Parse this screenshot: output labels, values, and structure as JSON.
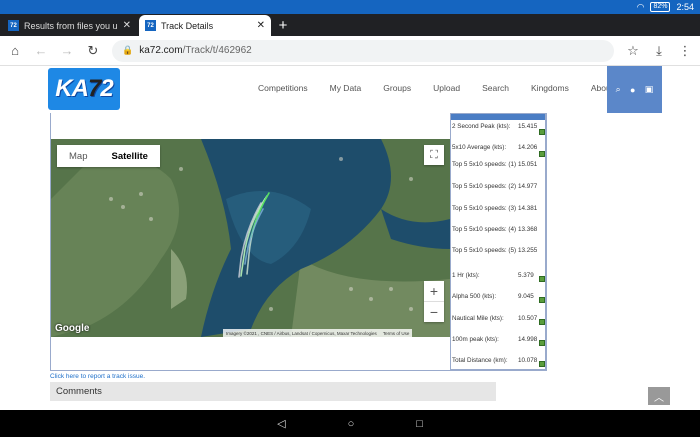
{
  "status_bar": {
    "battery": "82%",
    "time": "2:54"
  },
  "tabs": [
    {
      "title": "Results from files you uploa",
      "active": false
    },
    {
      "title": "Track Details",
      "active": true
    }
  ],
  "address": {
    "domain": "ka72.com",
    "path": "/Track/t/462962"
  },
  "site": {
    "logo_main": "KA",
    "logo_accent": "7",
    "logo_tail": "2",
    "nav": [
      "Competitions",
      "My Data",
      "Groups",
      "Upload",
      "Search",
      "Kingdoms",
      "About"
    ]
  },
  "map": {
    "toggle_map": "Map",
    "toggle_satellite": "Satellite",
    "google": "Google",
    "imagery": "Imagery ©2021 , CNES / Airbus, Landsat / Copernicus, Maxar Technologies",
    "terms": "Terms of Use",
    "zoom_in": "+",
    "zoom_out": "−"
  },
  "stats": [
    {
      "label": "2 Second Peak (kts):",
      "value": "15.415"
    },
    {
      "label": "5x10 Average (kts):",
      "value": "14.206"
    },
    {
      "label": "Top 5 5x10 speeds: (1)",
      "value": "15.051"
    },
    {
      "label": "Top 5 5x10 speeds: (2)",
      "value": "14.977"
    },
    {
      "label": "Top 5 5x10 speeds: (3)",
      "value": "14.381"
    },
    {
      "label": "Top 5 5x10 speeds: (4)",
      "value": "13.368"
    },
    {
      "label": "Top 5 5x10 speeds: (5)",
      "value": "13.255"
    },
    {
      "label": "1 Hr (kts):",
      "value": "5.379"
    },
    {
      "label": "Alpha 500 (kts):",
      "value": "9.045"
    },
    {
      "label": "Nautical Mile (kts):",
      "value": "10.507"
    },
    {
      "label": "100m peak (kts):",
      "value": "14.998"
    },
    {
      "label": "Total Distance (km):",
      "value": "10.078"
    }
  ],
  "report_link": "Click here to report a track issue.",
  "comments_title": "Comments"
}
